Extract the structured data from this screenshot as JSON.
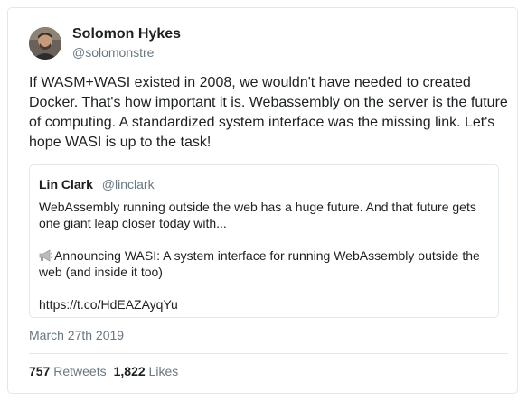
{
  "tweet": {
    "author": {
      "display_name": "Solomon Hykes",
      "handle": "@solomonstre",
      "avatar_icon": "avatar-photo"
    },
    "text": "If WASM+WASI existed in 2008, we wouldn't have needed to created Docker. That's how important it is. Webassembly on the server is the future of computing. A standardized system interface was the missing link. Let's hope WASI is up to the task!",
    "quoted": {
      "display_name": "Lin Clark",
      "handle": "@linclark",
      "line1": "WebAssembly running outside the web has a huge future. And that future gets one giant leap closer today with...",
      "line2_icon": "loudspeaker-icon",
      "line2": "Announcing WASI: A system interface for running WebAssembly outside the web (and inside it too)",
      "link": "https://t.co/HdEAZAyqYu"
    },
    "date": "March 27th 2019",
    "stats": {
      "retweets_count": "757",
      "retweets_label": "Retweets",
      "likes_count": "1,822",
      "likes_label": "Likes"
    }
  }
}
